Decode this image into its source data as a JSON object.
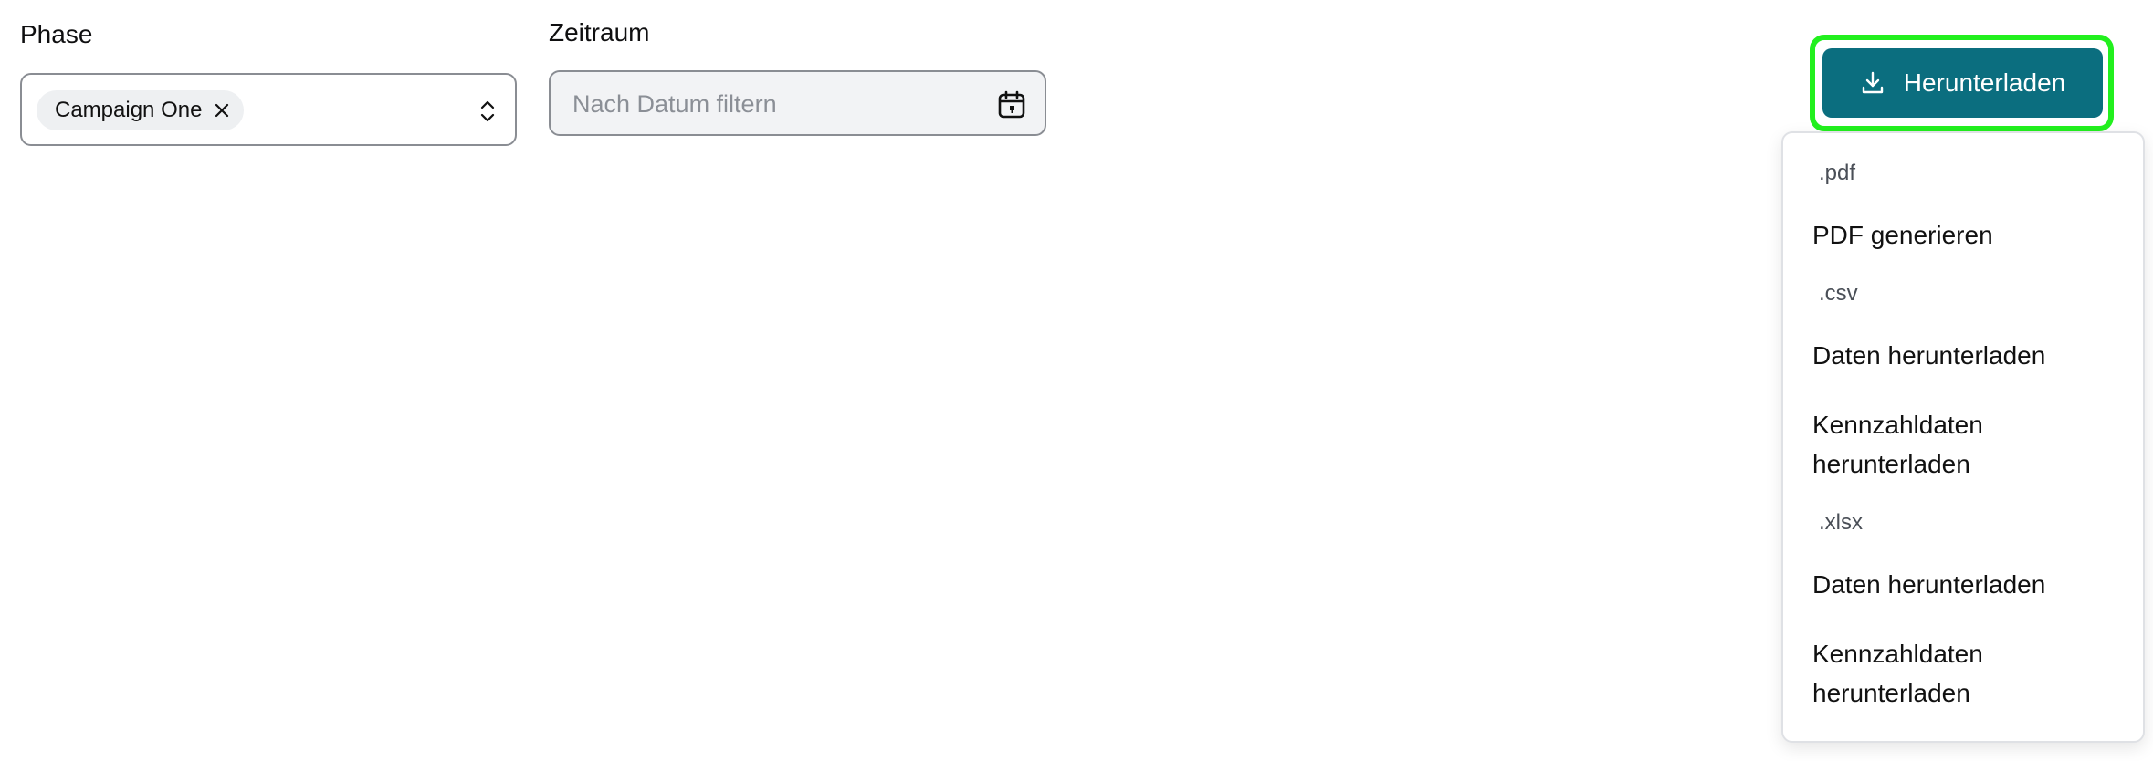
{
  "filters": {
    "phase": {
      "label": "Phase",
      "chip": "Campaign One"
    },
    "date": {
      "label": "Zeitraum",
      "placeholder": "Nach Datum filtern"
    }
  },
  "download": {
    "button_label": "Herunterladen",
    "accent_color": "#0b6e7f",
    "focus_color": "#22f01e",
    "menu": {
      "pdf": {
        "label": ".pdf",
        "items": [
          "PDF generieren"
        ]
      },
      "csv": {
        "label": ".csv",
        "items": [
          "Daten herunterladen",
          "Kennzahldaten herunterladen"
        ]
      },
      "xlsx": {
        "label": ".xlsx",
        "items": [
          "Daten herunterladen",
          "Kennzahldaten herunterladen"
        ]
      }
    }
  },
  "icons": {
    "chip_remove": "close-icon",
    "select_toggle": "chevron-up-down-icon",
    "date": "calendar-icon",
    "download": "download-icon"
  }
}
